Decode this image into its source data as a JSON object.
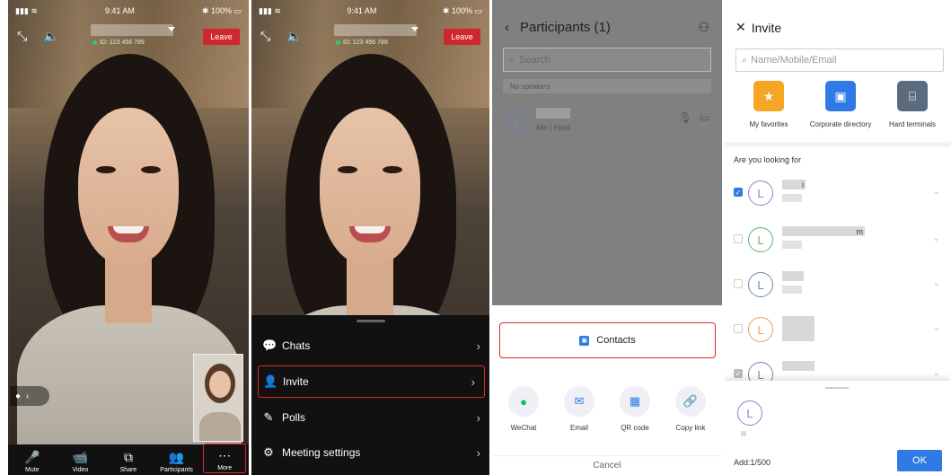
{
  "panel1": {
    "status": {
      "time": "9:41 AM",
      "battery": "100%"
    },
    "meeting_id": "ID: 123 456 789",
    "leave_label": "Leave",
    "toolbar": [
      {
        "icon": "mic-icon",
        "glyph": "🎤",
        "label": "Mute"
      },
      {
        "icon": "video-off-icon",
        "glyph": "📹",
        "label": "Video"
      },
      {
        "icon": "share-icon",
        "glyph": "⧉",
        "label": "Share"
      },
      {
        "icon": "participants-icon",
        "glyph": "👥",
        "label": "Participants"
      },
      {
        "icon": "more-icon",
        "glyph": "⋯",
        "label": "More"
      }
    ]
  },
  "panel2": {
    "status": {
      "time": "9:41 AM",
      "battery": "100%"
    },
    "meeting_id": "ID: 123 456 789",
    "leave_label": "Leave",
    "menu": [
      {
        "icon": "chat-icon",
        "label": "Chats"
      },
      {
        "icon": "invite-icon",
        "label": "Invite"
      },
      {
        "icon": "poll-icon",
        "label": "Polls"
      },
      {
        "icon": "settings-icon",
        "label": "Meeting settings"
      }
    ]
  },
  "panel3": {
    "title": "Participants (1)",
    "search_placeholder": "Search",
    "no_speakers": "No speakers",
    "participant_role": "Me | Host",
    "contacts_label": "Contacts",
    "share_options": [
      {
        "icon": "wechat-icon",
        "label": "WeChat",
        "color": "#07c160"
      },
      {
        "icon": "email-icon",
        "label": "Email",
        "color": "#2f7ae5"
      },
      {
        "icon": "qr-code-icon",
        "label": "QR code",
        "color": "#2f7ae5"
      },
      {
        "icon": "link-icon",
        "label": "Copy link",
        "color": "#2f7ae5"
      }
    ],
    "cancel_label": "Cancel"
  },
  "panel4": {
    "title": "Invite",
    "search_placeholder": "Name/Mobile/Email",
    "categories": [
      {
        "icon": "star-icon",
        "label": "My favorites",
        "color": "#f5a623"
      },
      {
        "icon": "directory-icon",
        "label": "Corporate directory",
        "color": "#2f7ae5"
      },
      {
        "icon": "terminal-icon",
        "label": "Hard terminals",
        "color": "#5a6b80"
      }
    ],
    "looking_for": "Are you looking for",
    "contacts": [
      {
        "suffix": "i",
        "checked": true,
        "color": "#9b7ac9"
      },
      {
        "suffix": "m",
        "checked": false,
        "color": "#5cb85c"
      },
      {
        "suffix": "",
        "checked": false,
        "color": "#6d8bb0"
      },
      {
        "suffix": "",
        "checked": false,
        "color": "#e8a060"
      },
      {
        "suffix": "",
        "checked": true,
        "color": "#6d8bb0"
      }
    ],
    "add_count": "Add:1/500",
    "ok_label": "OK"
  }
}
